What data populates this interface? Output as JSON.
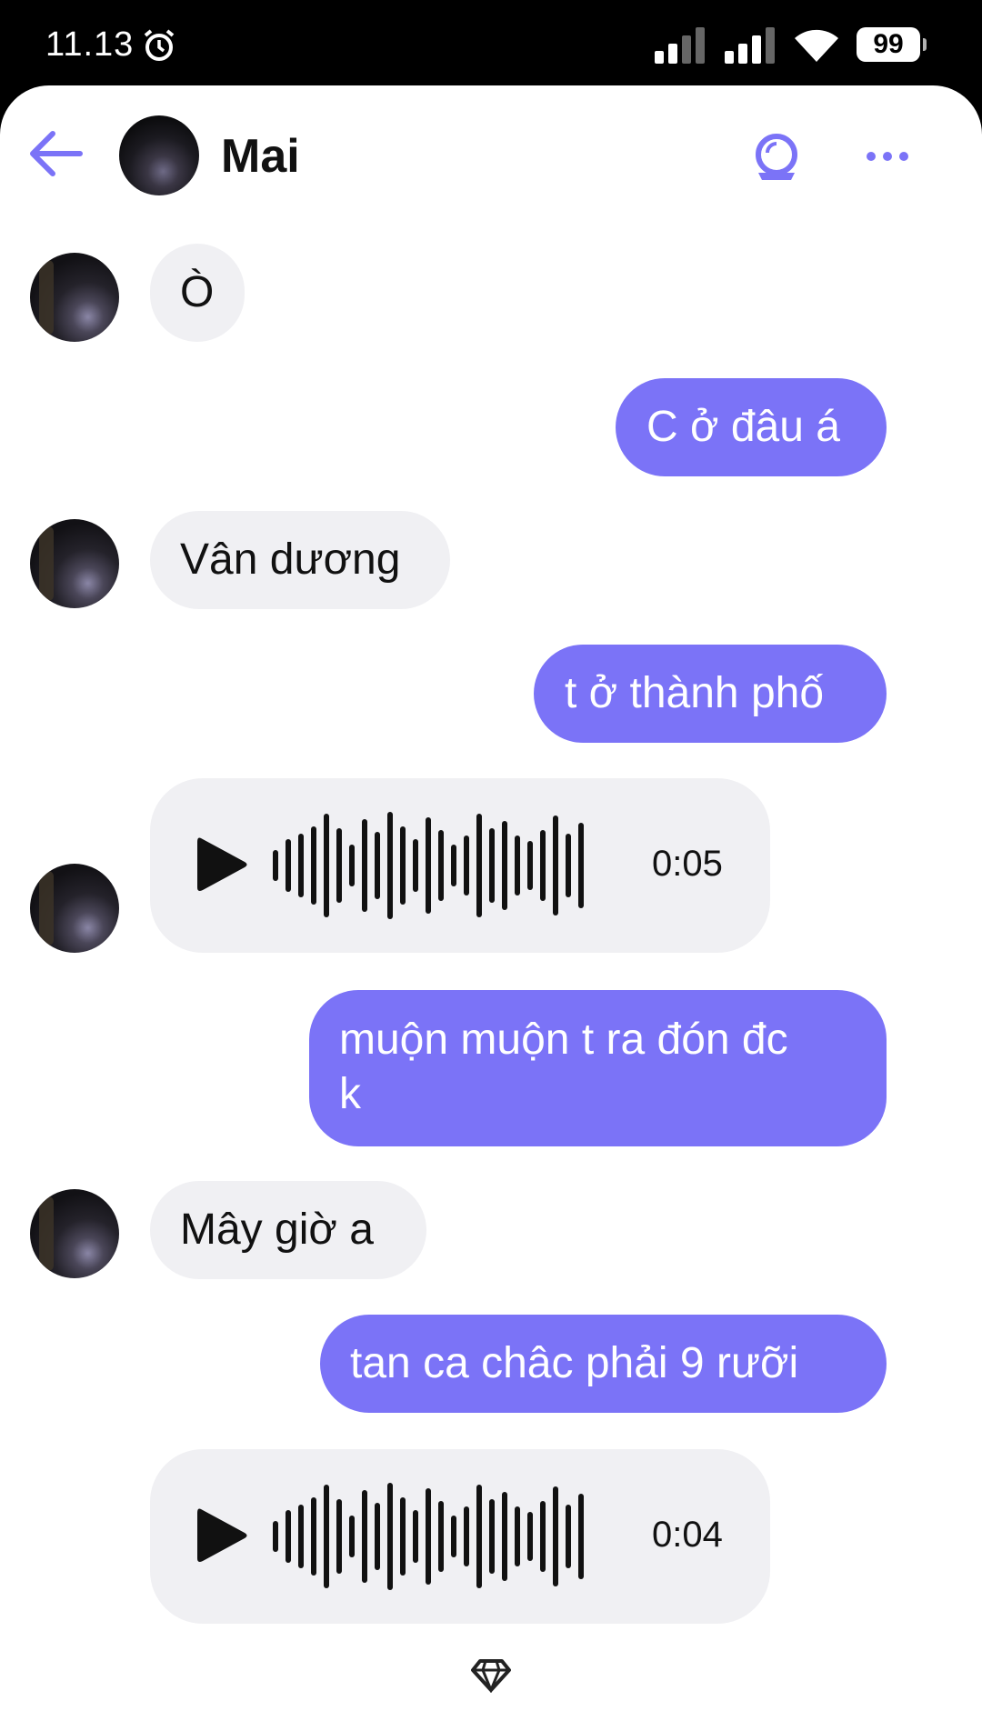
{
  "status_bar": {
    "time": "11.13",
    "battery": "99"
  },
  "header": {
    "contact_name": "Mai"
  },
  "messages": [
    {
      "dir": "in",
      "text": "Ò"
    },
    {
      "dir": "out",
      "text": "C ở đâu á"
    },
    {
      "dir": "in",
      "text": "Vân dương"
    },
    {
      "dir": "out",
      "text": "t ở thành phố"
    },
    {
      "dir": "in",
      "type": "voice",
      "duration": "0:05"
    },
    {
      "dir": "out",
      "text_line1": "muộn muộn t ra đón đc",
      "text_line2": "k"
    },
    {
      "dir": "in",
      "text": "Mây giờ a"
    },
    {
      "dir": "out",
      "text": "tan ca châc phải 9 rưỡi"
    },
    {
      "dir": "in",
      "type": "voice",
      "duration": "0:04"
    }
  ],
  "colors": {
    "accent": "#7b73f7",
    "incoming_bg": "#f0f0f3"
  },
  "icons": [
    "alarm-icon",
    "signal-icon",
    "wifi-icon",
    "battery-icon",
    "back-arrow-icon",
    "video-call-icon",
    "more-icon",
    "play-icon",
    "waveform-icon",
    "diamond-icon"
  ]
}
